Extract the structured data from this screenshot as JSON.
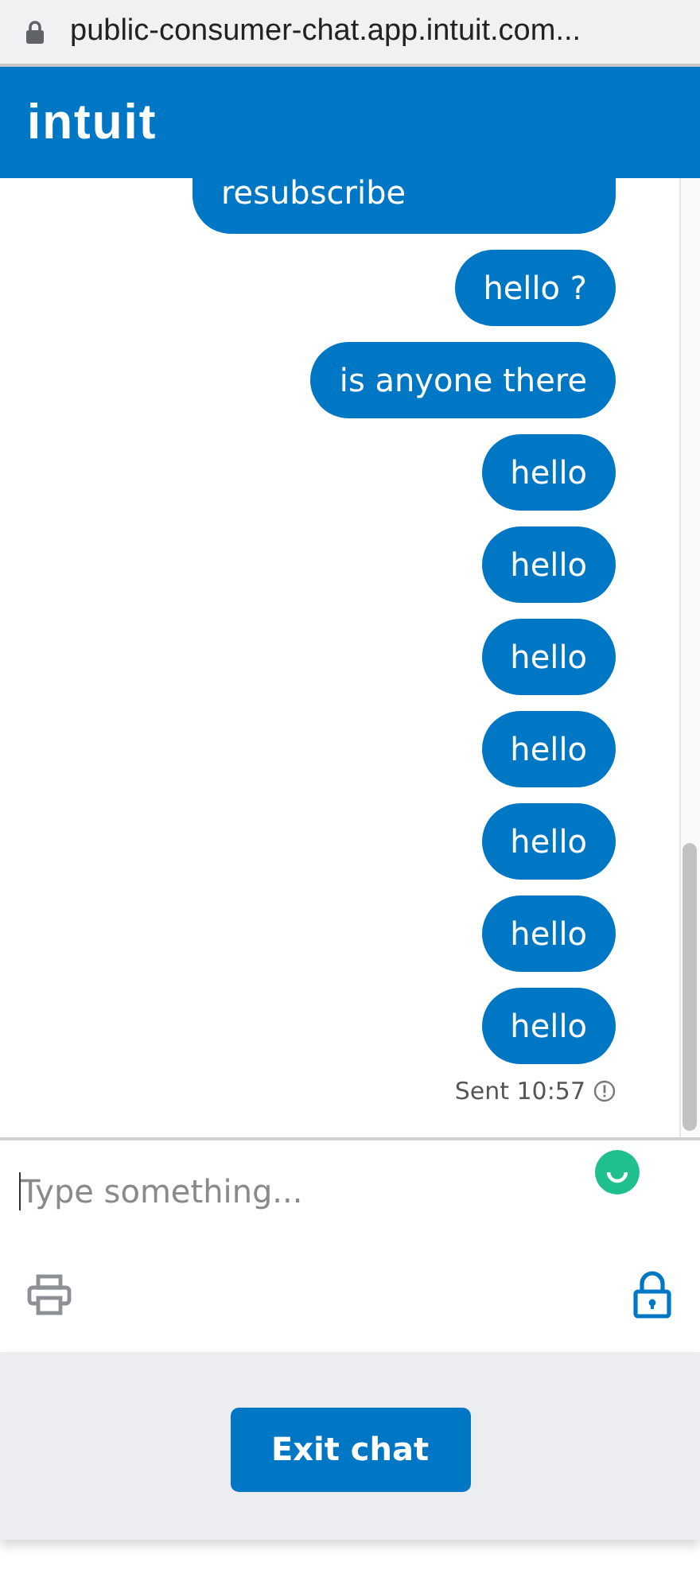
{
  "browser": {
    "url": "public-consumer-chat.app.intuit.com..."
  },
  "header": {
    "logo": "intuit"
  },
  "messages": [
    {
      "text": "resubscribe"
    },
    {
      "text": "hello ?"
    },
    {
      "text": "is anyone there"
    },
    {
      "text": "hello"
    },
    {
      "text": "hello"
    },
    {
      "text": "hello"
    },
    {
      "text": "hello"
    },
    {
      "text": "hello"
    },
    {
      "text": "hello"
    },
    {
      "text": "hello"
    }
  ],
  "status": {
    "text": "Sent 10:57"
  },
  "composer": {
    "placeholder": "Type something..."
  },
  "footer": {
    "button": "Exit chat"
  }
}
